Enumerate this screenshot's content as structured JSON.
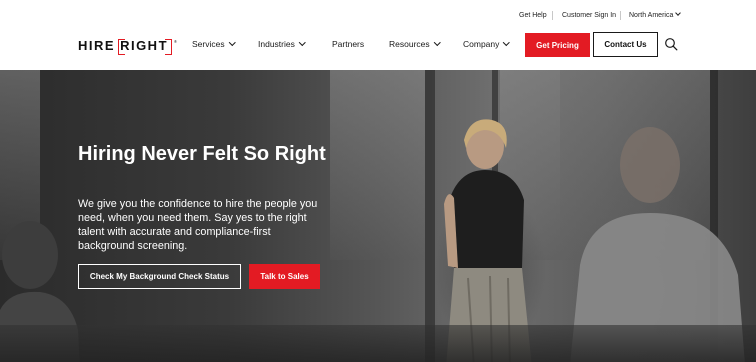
{
  "utility": {
    "get_help": "Get Help",
    "customer_sign_in": "Customer Sign In",
    "region": "North America"
  },
  "logo": {
    "part1": "HIRE",
    "part2": "RIGHT",
    "trademark": "®"
  },
  "nav": {
    "services": "Services",
    "industries": "Industries",
    "partners": "Partners",
    "resources": "Resources",
    "company": "Company"
  },
  "header_buttons": {
    "get_pricing": "Get Pricing",
    "contact_us": "Contact Us"
  },
  "hero": {
    "title": "Hiring Never Felt So Right",
    "description": "We give you the confidence to hire the people you need, when you need them. Say yes to the right talent with accurate and compliance-first background screening.",
    "btn_check_status": "Check My Background Check Status",
    "btn_talk_sales": "Talk to Sales"
  },
  "colors": {
    "brand_red": "#e31b23",
    "text_dark": "#1a1a1a",
    "white": "#ffffff"
  },
  "icons": {
    "search": "search-icon",
    "chevron": "chevron-down-icon"
  }
}
